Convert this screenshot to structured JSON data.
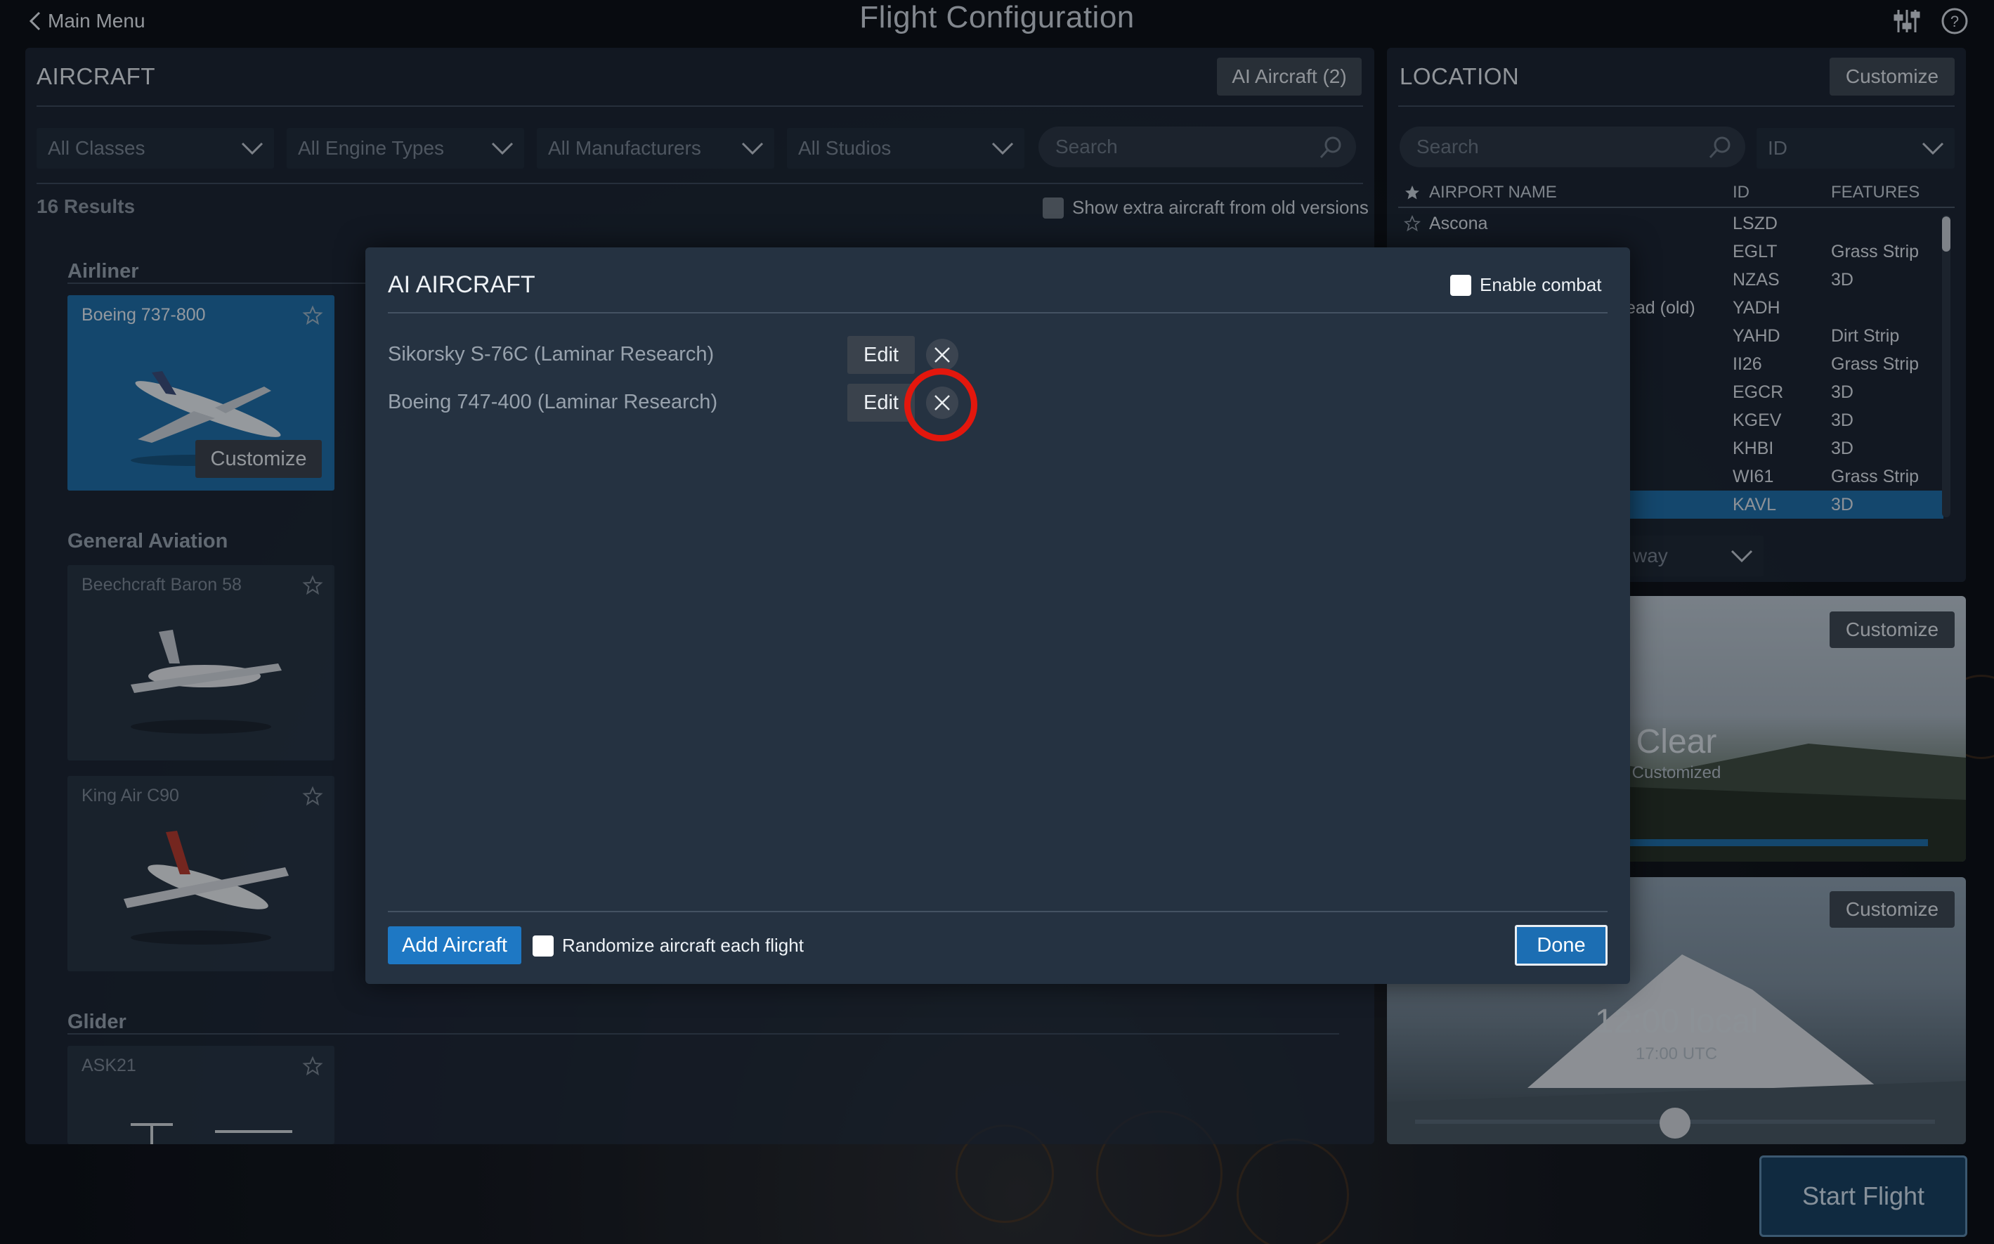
{
  "topbar": {
    "back_label": "Main Menu",
    "title": "Flight Configuration"
  },
  "aircraft_panel": {
    "title": "AIRCRAFT",
    "ai_aircraft_button": "AI Aircraft (2)",
    "filters": [
      "All Classes",
      "All Engine Types",
      "All Manufacturers",
      "All Studios"
    ],
    "search_placeholder": "Search",
    "results": "16 Results",
    "extra_label": "Show extra aircraft from old versions",
    "sections": {
      "airliner": "Airliner",
      "general_aviation": "General Aviation",
      "glider": "Glider"
    },
    "cards": {
      "boeing_737": "Boeing 737-800",
      "baron": "Beechcraft Baron 58",
      "king_air": "King Air C90",
      "ask21": "ASK21"
    },
    "customize_label": "Customize"
  },
  "location_panel": {
    "title": "LOCATION",
    "customize_label": "Customize",
    "search_placeholder": "Search",
    "id_dropdown": "ID",
    "columns": {
      "name": "AIRPORT NAME",
      "id": "ID",
      "features": "FEATURES"
    },
    "rows": [
      {
        "name": "Ascona",
        "id": "LSZD",
        "features": ""
      },
      {
        "name": "",
        "id": "EGLT",
        "features": "Grass Strip"
      },
      {
        "name": "",
        "id": "NZAS",
        "features": "3D"
      },
      {
        "name": "ead (old)",
        "id": "YADH",
        "features": ""
      },
      {
        "name": "",
        "id": "YAHD",
        "features": "Dirt Strip"
      },
      {
        "name": "",
        "id": "II26",
        "features": "Grass Strip"
      },
      {
        "name": "",
        "id": "EGCR",
        "features": "3D"
      },
      {
        "name": "",
        "id": "KGEV",
        "features": "3D"
      },
      {
        "name": "",
        "id": "KHBI",
        "features": "3D"
      },
      {
        "name": "",
        "id": "WI61",
        "features": "Grass Strip"
      },
      {
        "name": "",
        "id": "KAVL",
        "features": "3D"
      }
    ],
    "runway_partial": "way"
  },
  "weather_panel": {
    "customize_label": "Customize",
    "title": "Clear",
    "subtitle": "Customized"
  },
  "time_panel": {
    "customize_label": "Customize",
    "title": "12:00 local",
    "subtitle": "17:00 UTC",
    "time_fraction": 0.5
  },
  "start_flight": "Start Flight",
  "modal": {
    "title": "AI AIRCRAFT",
    "enable_combat": "Enable combat",
    "aircraft": [
      {
        "name": "Sikorsky S-76C (Laminar Research)",
        "edit": "Edit"
      },
      {
        "name": "Boeing 747-400 (Laminar Research)",
        "edit": "Edit"
      }
    ],
    "add_aircraft": "Add Aircraft",
    "randomize": "Randomize aircraft each flight",
    "done": "Done"
  },
  "colors": {
    "accent": "#1e78c4",
    "highlight": "#e3170d",
    "panel": "#253241"
  }
}
